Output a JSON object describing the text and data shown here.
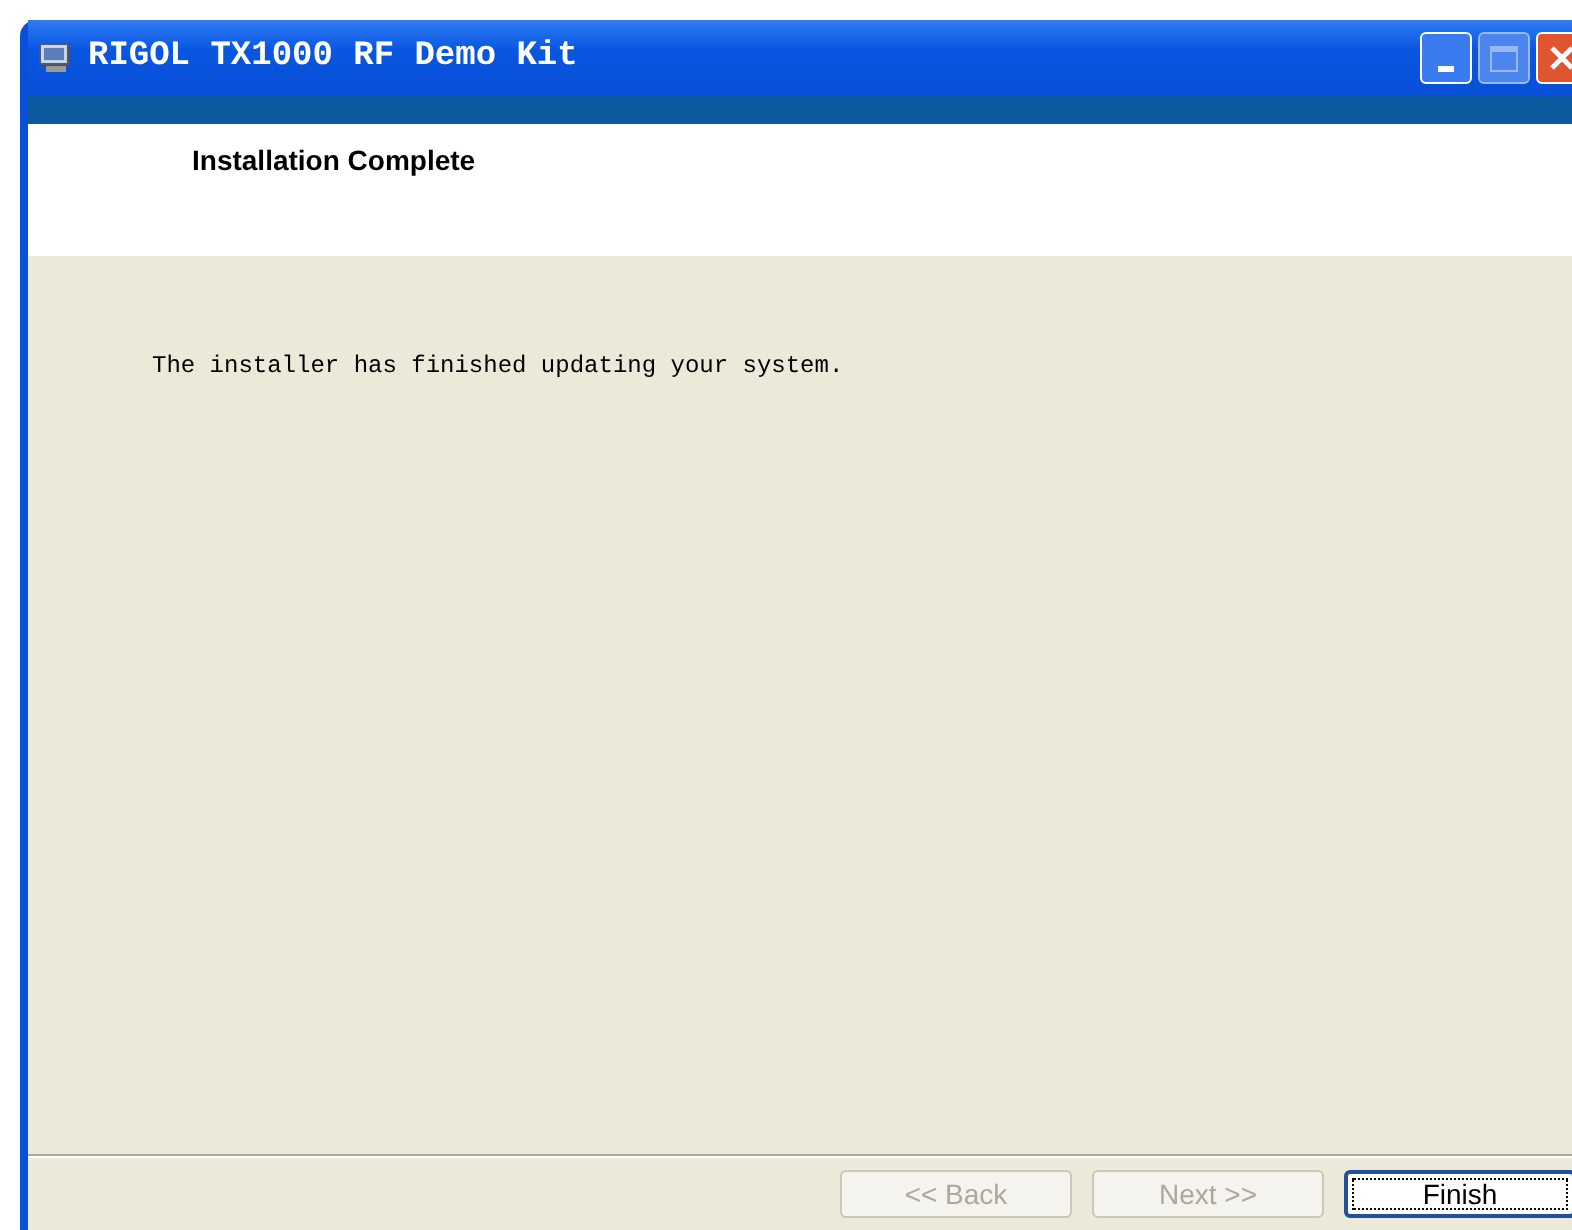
{
  "window": {
    "title": "RIGOL TX1000 RF Demo Kit"
  },
  "header": {
    "title": "Installation Complete"
  },
  "body": {
    "message": "The installer has finished updating your system."
  },
  "buttons": [
    {
      "label": "<< Back",
      "disabled": true,
      "focused": false
    },
    {
      "label": "Next >>",
      "disabled": true,
      "focused": false
    },
    {
      "label": "Finish",
      "disabled": false,
      "focused": true
    }
  ]
}
